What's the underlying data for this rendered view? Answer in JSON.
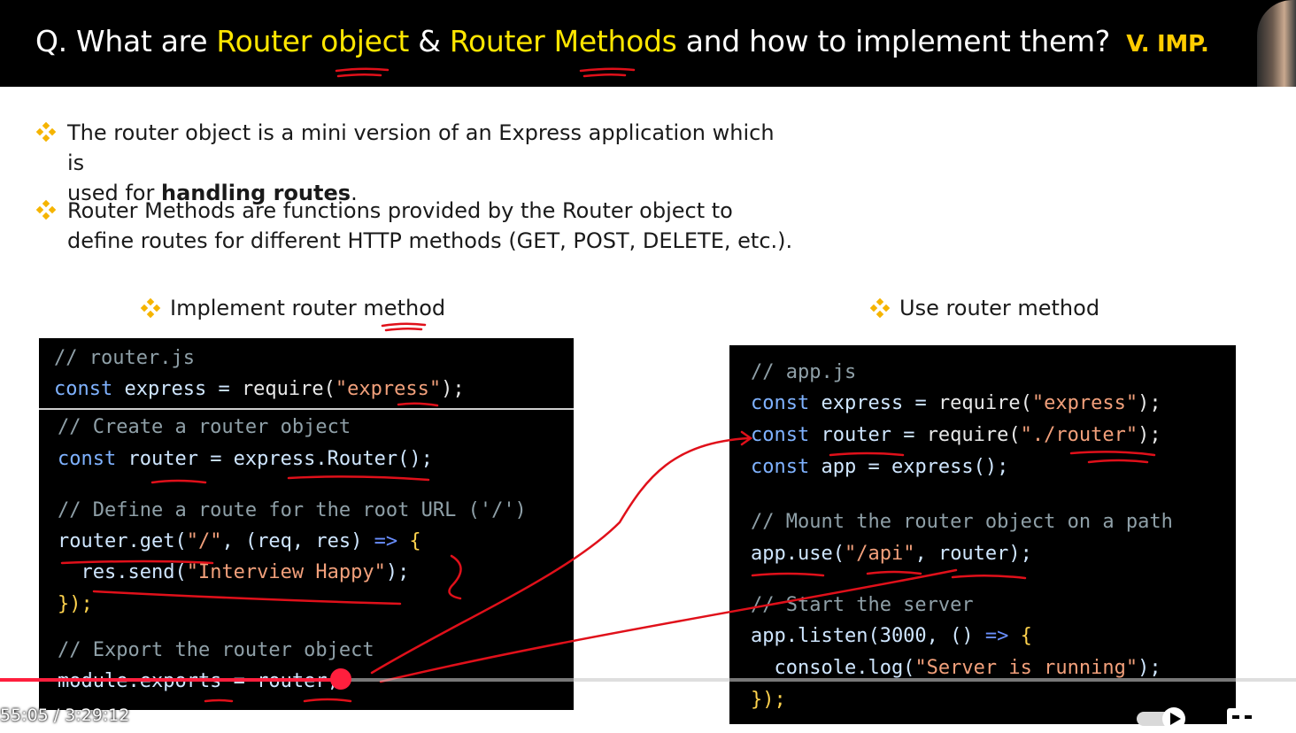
{
  "title": {
    "prefix": "Q. What are ",
    "term1": "Router object",
    "amp": " & ",
    "term2": "Router Methods",
    "suffix": " and how to implement them? ",
    "badge": "V. IMP."
  },
  "bullets": [
    {
      "text_a": "The router object is a mini version of an Express application which is",
      "text_b": "used for ",
      "bold": "handling routes",
      "text_c": "."
    },
    {
      "line1": "Router Methods are functions provided by the Router object to",
      "line2": "define routes for different HTTP methods (GET, POST, DELETE, etc.)."
    }
  ],
  "left_panel": {
    "label": "Implement router method",
    "lines": {
      "c1": "// router.js",
      "l2_kw": "const",
      "l2_id": " express = ",
      "l2_fn": "require(",
      "l2_str": "\"express\"",
      "l2_end": ");",
      "c3": "// Create a router object",
      "l4_kw": "const",
      "l4_rest": " router = express.Router();",
      "c5": "// Define a route for the root URL ('/')",
      "l6_a": "router.get(",
      "l6_str": "\"/\"",
      "l6_b": ", (req, res) ",
      "l6_ar": "=>",
      "l6_c": " {",
      "l7_a": "  res.send(",
      "l7_str": "\"Interview Happy\"",
      "l7_b": ");",
      "l8": "});",
      "c9": "// Export the router object",
      "l10": "module.exports = router;"
    }
  },
  "right_panel": {
    "label": "Use router method",
    "lines": {
      "c1": "// app.js",
      "l2_kw": "const",
      "l2_id": " express = ",
      "l2_fn": "require(",
      "l2_str": "\"express\"",
      "l2_end": ");",
      "l3_kw": "const",
      "l3_id": " router = ",
      "l3_fn": "require(",
      "l3_str": "\"./router\"",
      "l3_end": ");",
      "l4_kw": "const",
      "l4_rest": " app = express();",
      "c5": "// Mount the router object on a path",
      "l6_a": "app.use(",
      "l6_str": "\"/api\"",
      "l6_b": ", router);",
      "c7": "// Start the server",
      "l8_a": "app.listen(3000, () ",
      "l8_ar": "=>",
      "l8_b": " {",
      "l9_a": "  console.log(",
      "l9_str": "\"Server is running\"",
      "l9_b": ");",
      "l10": "});"
    }
  },
  "player": {
    "time": "55:05 / 3:29:12",
    "progress_fraction": 0.263
  },
  "colors": {
    "title_highlight": "#ffe600",
    "badge": "#ffcc00",
    "progress": "#ff1f3d",
    "annotation": "#e0101a",
    "diamond": "#f5b400"
  }
}
